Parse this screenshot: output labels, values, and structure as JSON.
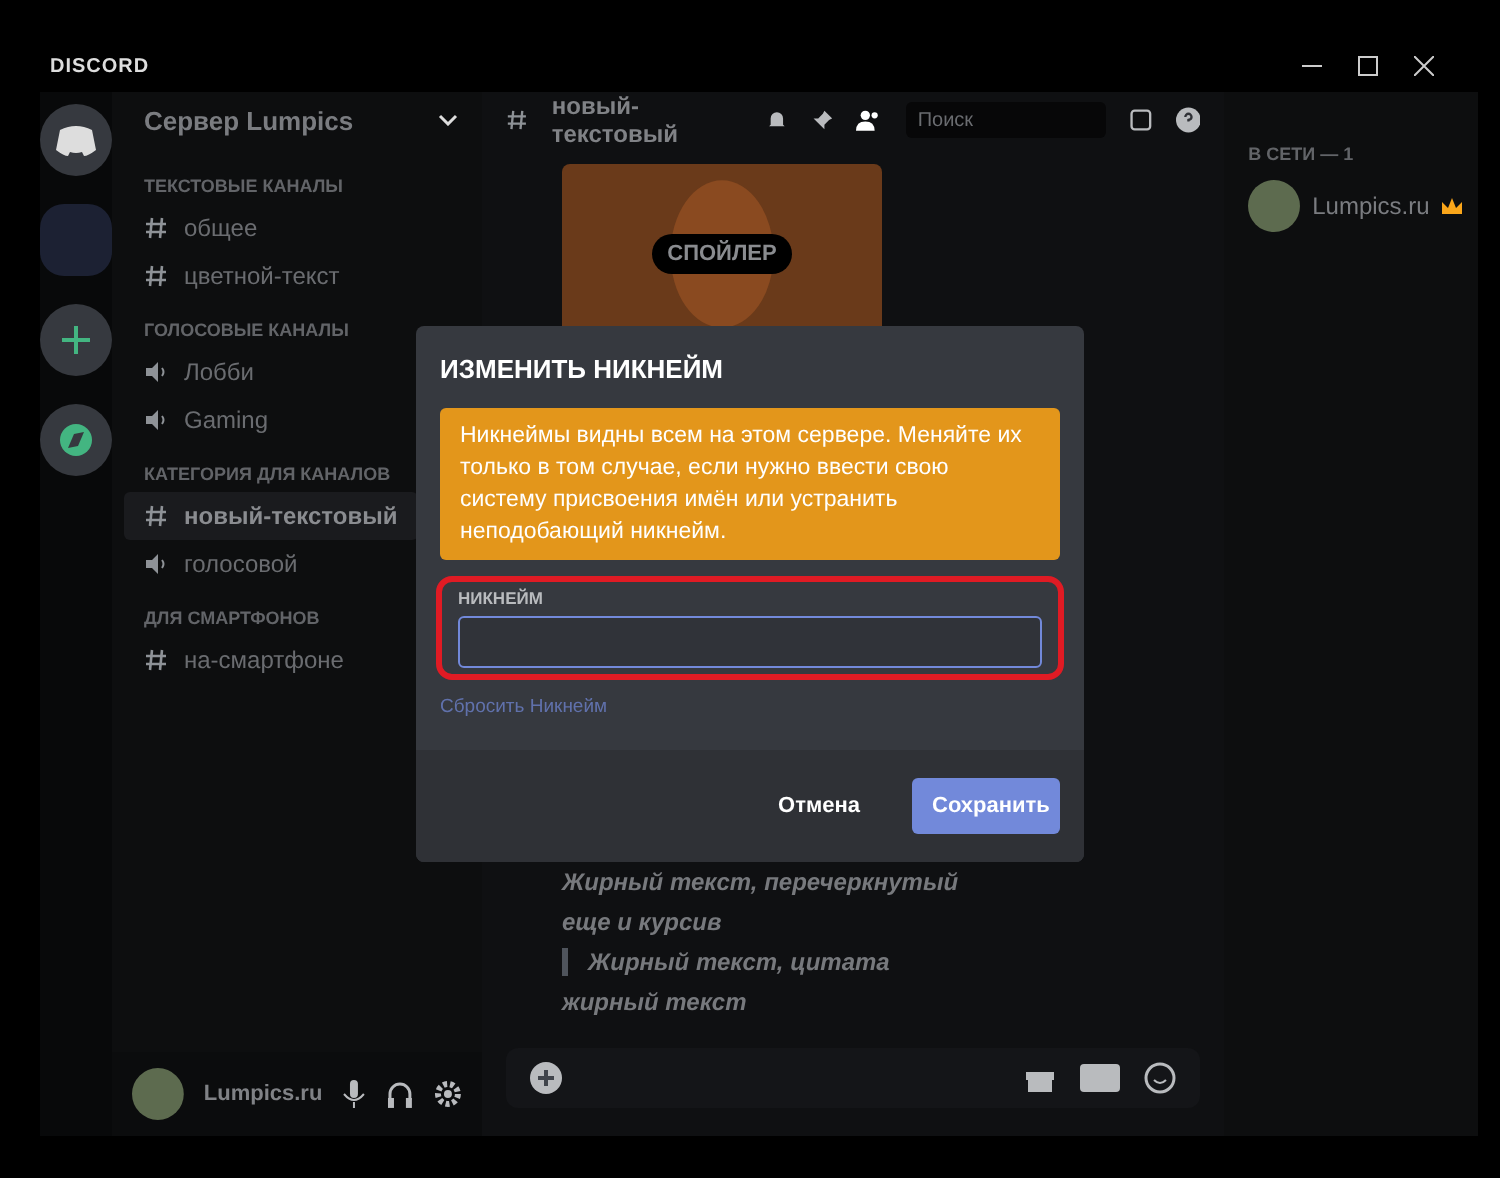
{
  "window": {
    "title": "DISCORD"
  },
  "server": {
    "name": "Сервер Lumpics"
  },
  "channel_groups": [
    {
      "name": "ТЕКСТОВЫЕ КАНАЛЫ",
      "channels": [
        {
          "name": "общее",
          "kind": "text",
          "selected": false
        },
        {
          "name": "цветной-текст",
          "kind": "text",
          "selected": false
        }
      ]
    },
    {
      "name": "ГОЛОСОВЫЕ КАНАЛЫ",
      "channels": [
        {
          "name": "Лобби",
          "kind": "voice",
          "selected": false
        },
        {
          "name": "Gaming",
          "kind": "voice",
          "selected": false
        }
      ]
    },
    {
      "name": "КАТЕГОРИЯ ДЛЯ КАНАЛОВ",
      "channels": [
        {
          "name": "новый-текстовый",
          "kind": "text",
          "selected": true
        },
        {
          "name": "голосовой",
          "kind": "voice",
          "selected": false
        }
      ]
    },
    {
      "name": "ДЛЯ СМАРТФОНОВ",
      "channels": [
        {
          "name": "на-смартфоне",
          "kind": "text",
          "selected": false
        }
      ]
    }
  ],
  "user": {
    "name": "Lumpics.ru"
  },
  "chat": {
    "channel": "новый-текстовый",
    "search": {
      "placeholder": "Поиск"
    },
    "spoiler": "СПОЙЛЕР",
    "messages": [
      {
        "text": "Жирный текст, перечеркнутый",
        "kind": "plain"
      },
      {
        "text": "еще и курсив",
        "kind": "plain"
      },
      {
        "text": "Жирный текст, цитата",
        "kind": "quote"
      },
      {
        "text": "жирный текст",
        "kind": "plain"
      }
    ]
  },
  "members": {
    "heading": "В СЕТИ — 1",
    "items": [
      {
        "name": "Lumpics.ru"
      }
    ]
  },
  "dialog": {
    "title": "ИЗМЕНИТЬ НИКНЕЙМ",
    "notice": "Никнеймы видны всем на этом сервере. Меняйте их только в том случае, если нужно ввести свою систему присвоения имён или устранить неподобающий никнейм.",
    "field_label": "НИКНЕЙМ",
    "reset_link": "Сбросить Никнейм",
    "buttons": [
      {
        "label": "Отмена",
        "kind": "secondary"
      },
      {
        "label": "Сохранить",
        "kind": "primary"
      }
    ]
  }
}
